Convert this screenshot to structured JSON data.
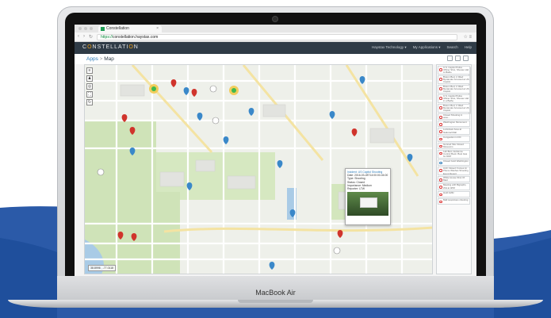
{
  "device": {
    "brand": "MacBook",
    "model": "Air"
  },
  "browser": {
    "tab_title": "Constellation",
    "url_scheme": "https://",
    "url_host": "constellation.haystax.com",
    "back_icon": "back-arrow-icon",
    "forward_icon": "forward-arrow-icon",
    "reload_icon": "reload-icon"
  },
  "app": {
    "logo_prefix": "C",
    "logo_rest": "NSTELLATI",
    "logo_end": "N",
    "nav": [
      "Haystax Technology ▾",
      "My Applications ▾",
      "Search",
      "Help"
    ]
  },
  "breadcrumb": {
    "root": "Apps",
    "separator": ">",
    "current": "Map"
  },
  "popup": {
    "lines": [
      "Incident: US Capitol Shooting",
      "Date: 2016-03-28T14:00:00-04:00",
      "Type: Shooting",
      "Status: Closed",
      "Importance: Medium",
      "Reporter: LTW"
    ]
  },
  "side_list": [
    {
      "icon": "red",
      "text": "U.S. Capitol Police Officer Shot, Shooter Hid to Bathe"
    },
    {
      "icon": "red",
      "text": "Breton Bed, 2 Jilted Bystander Arrested at US Capitol"
    },
    {
      "icon": "red",
      "text": "Breton Bed, 2 Jilted Bystander Arrested at US Capitol"
    },
    {
      "icon": "red",
      "text": "U.S. Capitol Police Officer Shot, Shooter Hid in a Bathe"
    },
    {
      "icon": "red",
      "text": "Breton Bed, 2 Jilted Bystander Arrested at US Capitol"
    },
    {
      "icon": "red",
      "text": "Closed Shooting in area..."
    },
    {
      "icon": "red",
      "text": "Washington Monument"
    },
    {
      "icon": "red",
      "text": "Lockdown Area at National Mall"
    },
    {
      "icon": "red",
      "text": "Congestion in DC"
    },
    {
      "icon": "red",
      "text": "Gunned Site Closed Museums"
    },
    {
      "icon": "red",
      "text": "Lab Bust, Evidence Control Book: Bust Gas for DDP"
    },
    {
      "icon": "blue",
      "text": "Closed Gold Washington"
    },
    {
      "icon": "red",
      "text": "Arch Closed: Fumes At Phone Washes Shooting Event Report"
    },
    {
      "icon": "red",
      "text": "White House Shot Of Bald"
    },
    {
      "icon": "red",
      "text": "Meeting with Bigraphs, WH at 4PM"
    },
    {
      "icon": "red",
      "text": "Hold traffic"
    },
    {
      "icon": "red",
      "text": "Mall suspicious shooting"
    }
  ],
  "map": {
    "tools": [
      "layers-icon",
      "person-icon",
      "target-icon",
      "fullscreen-icon",
      "refresh-icon"
    ],
    "scale_text": "38.8996 , -77.0118"
  },
  "colors": {
    "header_bg": "#2f3b46",
    "accent_orange": "#f0a11a",
    "wave_blue": "#1f4f9c",
    "marker_red": "#d0342c",
    "marker_blue": "#3a88c9"
  }
}
